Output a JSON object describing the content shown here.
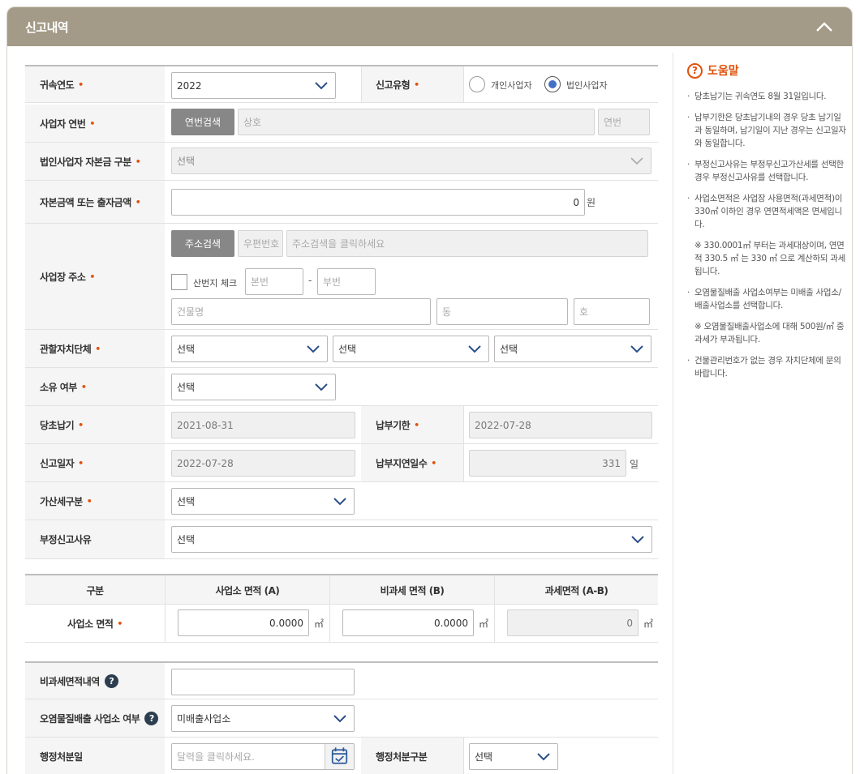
{
  "header": {
    "title": "신고내역"
  },
  "form": {
    "year_label": "귀속연도",
    "year_value": "2022",
    "report_type_label": "신고유형",
    "radio_individual": "개인사업자",
    "radio_corporate": "법인사업자",
    "business_label": "사업자 연번",
    "business_search_btn": "연번검색",
    "business_name_ph": "상호",
    "business_serial_ph": "연번",
    "capital_class_label": "법인사업자 자본금 구분",
    "capital_class_value": "선택",
    "capital_amount_label": "자본금액 또는 출자금액",
    "capital_amount_value": "0",
    "capital_unit": "원",
    "address_label": "사업장 주소",
    "address_search_btn": "주소검색",
    "zip_ph": "우편번호",
    "address_ph": "주소검색을 클릭하세요",
    "mountain_check_label": "산번지 체크",
    "main_no_ph": "본번",
    "dash": "-",
    "sub_no_ph": "부번",
    "building_ph": "건물명",
    "dong_ph": "동",
    "ho_ph": "호",
    "jurisdiction_label": "관할자치단체",
    "jurisdiction_1": "선택",
    "jurisdiction_2": "선택",
    "jurisdiction_3": "선택",
    "ownership_label": "소유 여부",
    "ownership_value": "선택",
    "original_due_label": "당초납기",
    "original_due_value": "2021-08-31",
    "payment_deadline_label": "납부기한",
    "payment_deadline_value": "2022-07-28",
    "report_date_label": "신고일자",
    "report_date_value": "2022-07-28",
    "late_days_label": "납부지연일수",
    "late_days_value": "331",
    "late_days_unit": "일",
    "penalty_label": "가산세구분",
    "penalty_value": "선택",
    "improper_label": "부정신고사유",
    "improper_value": "선택"
  },
  "area": {
    "col_category": "구분",
    "col_business": "사업소 면적 (A)",
    "col_nontax": "비과세 면적 (B)",
    "col_taxable": "과세면적 (A-B)",
    "row_label": "사업소 면적",
    "business_value": "0.0000",
    "nontax_value": "0.0000",
    "taxable_value": "0",
    "unit": "㎡"
  },
  "extra": {
    "nontax_detail_label": "비과세면적내역",
    "pollutant_label": "오염물질배출 사업소 여부",
    "pollutant_value": "미배출사업소",
    "admin_date_label": "행정처분일",
    "admin_date_ph": "달력을 클릭하세요.",
    "admin_type_label": "행정처분구분",
    "admin_type_value": "선택"
  },
  "help": {
    "title": "도움말",
    "items": [
      "당초납기는 귀속연도 8월 31일입니다.",
      "납부기한은 당초납기내의 경우 당초 납기일과 동일하며, 납기일이 지난 경우는 신고일자와 동일합니다.",
      "부정신고사유는 부정무신고가산세를 선택한 경우 부정신고사유를 선택합니다.",
      "사업소면적은 사업장 사용면적(과세면적)이 330㎡ 이하인 경우 연면적세액은 면세입니다.",
      "※ 330.0001㎡ 부터는 과세대상이며, 연면적 330.5 ㎡ 는 330 ㎡ 으로 계산하되 과세됩니다.",
      "오염물질배출 사업소여부는 미배출 사업소/배출사업소를 선택합니다.",
      "※ 오염물질배출사업소에 대해 500원/㎡ 중과세가 부과됩니다.",
      "건물관리번호가 없는 경우 자치단체에 문의바랍니다."
    ]
  },
  "colors": {
    "header_bg": "#a39a87",
    "required": "#e1510b",
    "button": "#878787",
    "radio_on": "#4470c4"
  }
}
